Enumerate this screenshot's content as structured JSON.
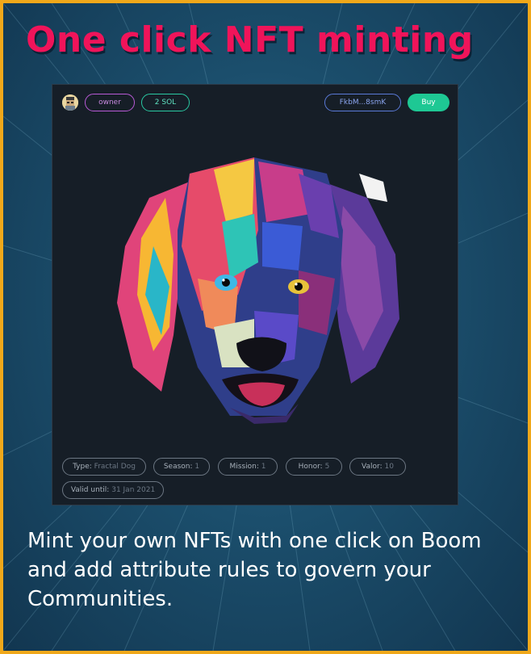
{
  "headline": "One click NFT minting",
  "card": {
    "owner_label": "owner",
    "price": "2 SOL",
    "address": "FkbM...8smK",
    "buy_label": "Buy",
    "image_subject": "fractal-dog-portrait",
    "attributes": [
      {
        "key": "Type:",
        "value": "Fractal Dog"
      },
      {
        "key": "Season:",
        "value": "1"
      },
      {
        "key": "Mission:",
        "value": "1"
      },
      {
        "key": "Honor:",
        "value": "5"
      },
      {
        "key": "Valor:",
        "value": "10"
      },
      {
        "key": "Valid until:",
        "value": "31 Jan 2021"
      }
    ]
  },
  "description": "Mint your own NFTs with one click on Boom and add attribute rules to govern your Communities.",
  "colors": {
    "border": "#f0a81a",
    "headline": "#f0145a",
    "buy": "#1ec894",
    "owner_pill": "#b85ad6",
    "price_pill": "#29c9a2",
    "address_pill": "#5a7ad8"
  }
}
